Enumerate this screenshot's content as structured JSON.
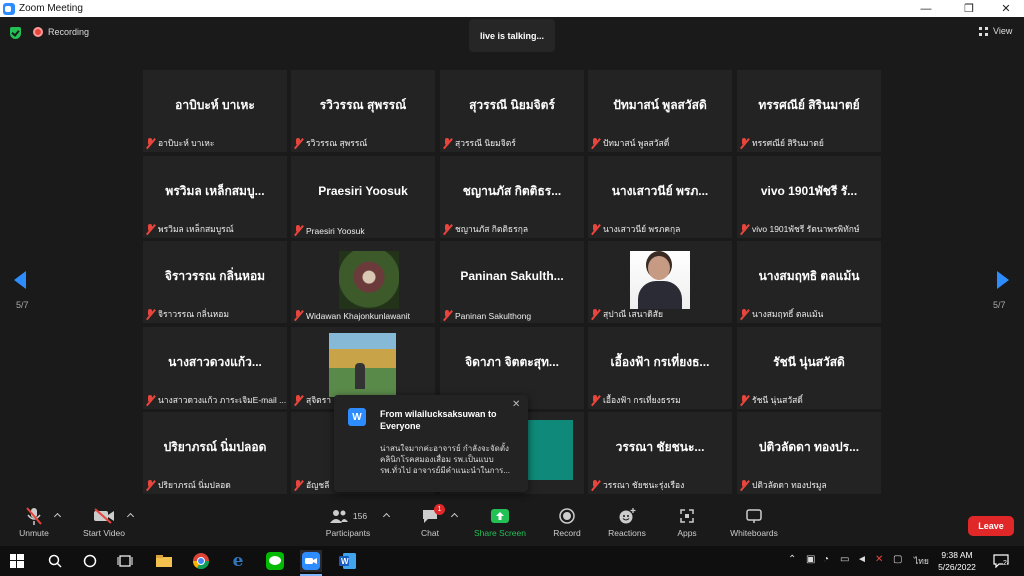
{
  "window": {
    "title": "Zoom Meeting"
  },
  "topbar": {
    "recording": "Recording",
    "talking": "live is talking...",
    "view": "View"
  },
  "nav": {
    "left_page": "5/7",
    "right_page": "5/7"
  },
  "tiles": [
    {
      "big": "อาบิบะห์      บาเหะ",
      "name": "อาบิบะห์      บาเหะ"
    },
    {
      "big": "รวิวรรณ สุพรรณ์",
      "name": "รวิวรรณ สุพรรณ์"
    },
    {
      "big": "สุวรรณี นิยมจิตร์",
      "name": "สุวรรณี นิยมจิตร์"
    },
    {
      "big": "ปัทมาสน์ พูลสวัสดิ",
      "name": "ปัทมาสน์ พูลสวัสดิ์"
    },
    {
      "big": "ทรรศณีย์ สิรินมาตย์",
      "name": "ทรรศณีย์ สิรินมาตย์"
    },
    {
      "big": "พรวิมล เหล็กสมบู...",
      "name": "พรวิมล เหล็กสมบูรณ์"
    },
    {
      "big": "Praesiri Yoosuk",
      "name": "Praesiri Yoosuk"
    },
    {
      "big": "ชญานภัส  กิตติธร...",
      "name": "ชญานภัส  กิตติธรกุล"
    },
    {
      "big": "นางเสาวนีย์ พรภ...",
      "name": "นางเสาวนีย์ พรภคกุล"
    },
    {
      "big": "vivo 1901พัชรี รั...",
      "name": "vivo 1901พัชรี รัตนาพรพิทักษ์"
    },
    {
      "big": "จิราวรรณ กลิ่นหอม",
      "name": "จิราวรรณ กลิ่นหอม"
    },
    {
      "big": "",
      "name": "Widawan Khajonkunlawanit"
    },
    {
      "big": "Paninan  Sakulth...",
      "name": "Paninan Sakulthong"
    },
    {
      "big": "",
      "name": "สุปาณี เสนาดิสัย"
    },
    {
      "big": "นางสมฤทธิ ตลแม้น",
      "name": "นางสมฤทธิ์ ตลแม้น"
    },
    {
      "big": "นางสาวดวงแก้ว...",
      "name": "นางสาวดวงแก้ว ภาระเจิมE-mail ..."
    },
    {
      "big": "",
      "name": "สุจิตรา"
    },
    {
      "big": "จิดาภา  จิตตะสุท...",
      "name": "จิดาภา จิตตะสุทธิ"
    },
    {
      "big": "เอื้องฟ้า กรเที่ยงธ...",
      "name": "เอื้องฟ้า กรเที่ยงธรรม"
    },
    {
      "big": "รัชนี นุ่นสวัสดิ",
      "name": "รัชนี นุ่นสวัสดิ์"
    },
    {
      "big": "ปริยาภรณ์ นิ่มปลอด",
      "name": "ปริยาภรณ์ นิ่มปลอด"
    },
    {
      "big": "อั",
      "name": "อัญชลี"
    },
    {
      "big": "",
      "name": "gul"
    },
    {
      "big": "วรรณา     ชัยชนะ...",
      "name": "วรรณา     ชัยชนะรุ่งเรือง"
    },
    {
      "big": "ปติวลัดดา ทองปร...",
      "name": "ปติวลัดดา ทองปรมูล"
    }
  ],
  "chat_popup": {
    "avatar": "W",
    "from": "From wilailucksaksuwan to Everyone",
    "message": "น่าสนใจมากค่ะอาจารย์ กำลังจะจัดตั้งคลินิกโรคสมองเสื่อม รพ.เป็นแบบ รพ.ทั่วไป อาจารย์มีคำแนะนำในการ..."
  },
  "toolbar": {
    "unmute": "Unmute",
    "start_video": "Start Video",
    "participants": "Participants",
    "participant_count": "156",
    "chat": "Chat",
    "chat_badge": "1",
    "share": "Share Screen",
    "record": "Record",
    "reactions": "Reactions",
    "apps": "Apps",
    "whiteboards": "Whiteboards",
    "leave": "Leave"
  },
  "taskbar": {
    "time": "9:38 AM",
    "date": "5/26/2022",
    "lang": "ไทย",
    "notif": "2"
  },
  "colors": {
    "accent": "#2d8cff",
    "leave": "#e02828",
    "share": "#23c055",
    "muted": "#e8453c"
  }
}
